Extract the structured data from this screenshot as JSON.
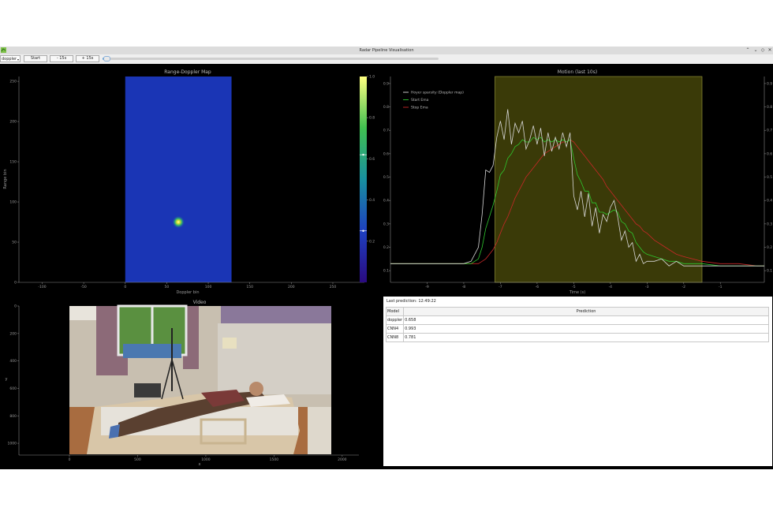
{
  "window": {
    "title": "Radar Pipeline Visualisation",
    "controls": [
      "⌃",
      "⌄",
      "◇",
      "✕"
    ]
  },
  "toolbar": {
    "mode_value": "doppler",
    "start_label": "Start",
    "back_label": "- 15s",
    "forward_label": "+ 15s",
    "timeline_position": 0.01
  },
  "range_doppler": {
    "title": "Range-Doppler Map",
    "xlabel": "Doppler bin",
    "ylabel": "Range bin",
    "x_ticks": [
      "-100",
      "-50",
      "0",
      "50",
      "100",
      "150",
      "200",
      "250"
    ],
    "y_ticks": [
      "0",
      "50",
      "100",
      "150",
      "200",
      "250"
    ],
    "colorbar_ticks": [
      "0.2",
      "0.4",
      "0.6",
      "0.8",
      "1.0"
    ],
    "colorbar_markers": [
      0.62,
      0.25
    ]
  },
  "motion": {
    "title": "Motion (last 10s)",
    "xlabel": "Time (s)",
    "x_ticks": [
      "-9",
      "-8",
      "-7",
      "-6",
      "-5",
      "-4",
      "-3",
      "-2",
      "-1"
    ],
    "y_ticks": [
      "0.1",
      "0.2",
      "0.3",
      "0.4",
      "0.5",
      "0.6",
      "0.7",
      "0.8",
      "0.9"
    ]
  },
  "video": {
    "title": "Video",
    "xlabel": "x",
    "ylabel": "y",
    "x_ticks": [
      "0",
      "500",
      "1000",
      "1500",
      "2000"
    ],
    "y_ticks": [
      "0",
      "200",
      "400",
      "600",
      "800",
      "1000"
    ]
  },
  "prediction": {
    "last_prediction": "Last prediction: 12:49:22",
    "col_model": "Model",
    "col_prediction": "Prediction",
    "rows": [
      {
        "model": "doppler",
        "value": "0.658"
      },
      {
        "model": "CNN4",
        "value": "0.993"
      },
      {
        "model": "CNN8",
        "value": "0.781"
      }
    ]
  },
  "chart_data": [
    {
      "type": "heatmap",
      "title": "Range-Doppler Map",
      "xlabel": "Doppler bin",
      "ylabel": "Range bin",
      "xlim": [
        -128,
        288
      ],
      "ylim": [
        0,
        256
      ],
      "data_extent": {
        "x": [
          0,
          128
        ],
        "y": [
          0,
          256
        ]
      },
      "peak": {
        "x": 64,
        "y": 75,
        "value": 1.0
      },
      "background_value": 0.05,
      "colorbar_range": [
        0,
        1.0
      ]
    },
    {
      "type": "line",
      "title": "Motion (last 10s)",
      "xlabel": "Time (s)",
      "xlim": [
        -10,
        0.2
      ],
      "ylim": [
        0.05,
        0.93
      ],
      "highlight_span": [
        -7.15,
        -1.5
      ],
      "x": [
        -10,
        -9.5,
        -9,
        -8.5,
        -8,
        -7.8,
        -7.6,
        -7.5,
        -7.4,
        -7.3,
        -7.2,
        -7.1,
        -7.0,
        -6.9,
        -6.8,
        -6.7,
        -6.6,
        -6.5,
        -6.4,
        -6.3,
        -6.2,
        -6.1,
        -6.0,
        -5.9,
        -5.8,
        -5.7,
        -5.6,
        -5.5,
        -5.4,
        -5.3,
        -5.2,
        -5.1,
        -5.0,
        -4.9,
        -4.8,
        -4.7,
        -4.6,
        -4.5,
        -4.4,
        -4.3,
        -4.2,
        -4.1,
        -4.0,
        -3.9,
        -3.8,
        -3.7,
        -3.6,
        -3.5,
        -3.4,
        -3.3,
        -3.2,
        -3.1,
        -3.0,
        -2.8,
        -2.6,
        -2.4,
        -2.2,
        -2.0,
        -1.5,
        -1.0,
        -0.5,
        0.0,
        0.2
      ],
      "series": [
        {
          "name": "Hoyer sparsity (Doppler map)",
          "color": "#d8d8d8",
          "values": [
            0.13,
            0.13,
            0.13,
            0.13,
            0.13,
            0.14,
            0.2,
            0.34,
            0.53,
            0.52,
            0.55,
            0.67,
            0.74,
            0.66,
            0.79,
            0.64,
            0.73,
            0.69,
            0.74,
            0.62,
            0.66,
            0.72,
            0.64,
            0.71,
            0.59,
            0.69,
            0.61,
            0.67,
            0.62,
            0.69,
            0.63,
            0.69,
            0.42,
            0.36,
            0.44,
            0.33,
            0.43,
            0.29,
            0.37,
            0.26,
            0.34,
            0.31,
            0.37,
            0.4,
            0.33,
            0.23,
            0.27,
            0.2,
            0.22,
            0.14,
            0.17,
            0.13,
            0.14,
            0.14,
            0.15,
            0.12,
            0.14,
            0.12,
            0.12,
            0.12,
            0.12,
            0.12,
            0.12
          ]
        },
        {
          "name": "Start Ema",
          "color": "#2ec82e",
          "values": [
            0.13,
            0.13,
            0.13,
            0.13,
            0.13,
            0.13,
            0.15,
            0.2,
            0.28,
            0.33,
            0.38,
            0.44,
            0.51,
            0.53,
            0.58,
            0.6,
            0.63,
            0.64,
            0.66,
            0.65,
            0.65,
            0.67,
            0.66,
            0.67,
            0.65,
            0.66,
            0.65,
            0.66,
            0.65,
            0.66,
            0.65,
            0.66,
            0.58,
            0.51,
            0.48,
            0.44,
            0.44,
            0.39,
            0.39,
            0.35,
            0.35,
            0.34,
            0.35,
            0.36,
            0.35,
            0.31,
            0.3,
            0.27,
            0.26,
            0.22,
            0.2,
            0.18,
            0.17,
            0.16,
            0.15,
            0.14,
            0.14,
            0.13,
            0.13,
            0.12,
            0.12,
            0.12,
            0.12
          ]
        },
        {
          "name": "Stop Ema",
          "color": "#c82828",
          "values": [
            0.13,
            0.13,
            0.13,
            0.13,
            0.13,
            0.13,
            0.13,
            0.14,
            0.15,
            0.17,
            0.19,
            0.22,
            0.26,
            0.3,
            0.33,
            0.37,
            0.41,
            0.44,
            0.47,
            0.5,
            0.52,
            0.54,
            0.56,
            0.58,
            0.6,
            0.61,
            0.62,
            0.63,
            0.64,
            0.65,
            0.65,
            0.66,
            0.65,
            0.63,
            0.61,
            0.59,
            0.57,
            0.55,
            0.53,
            0.51,
            0.49,
            0.46,
            0.44,
            0.42,
            0.4,
            0.38,
            0.36,
            0.34,
            0.32,
            0.3,
            0.29,
            0.27,
            0.26,
            0.23,
            0.21,
            0.19,
            0.17,
            0.16,
            0.14,
            0.13,
            0.13,
            0.12,
            0.12
          ]
        }
      ],
      "legend_position": "top-left"
    }
  ]
}
